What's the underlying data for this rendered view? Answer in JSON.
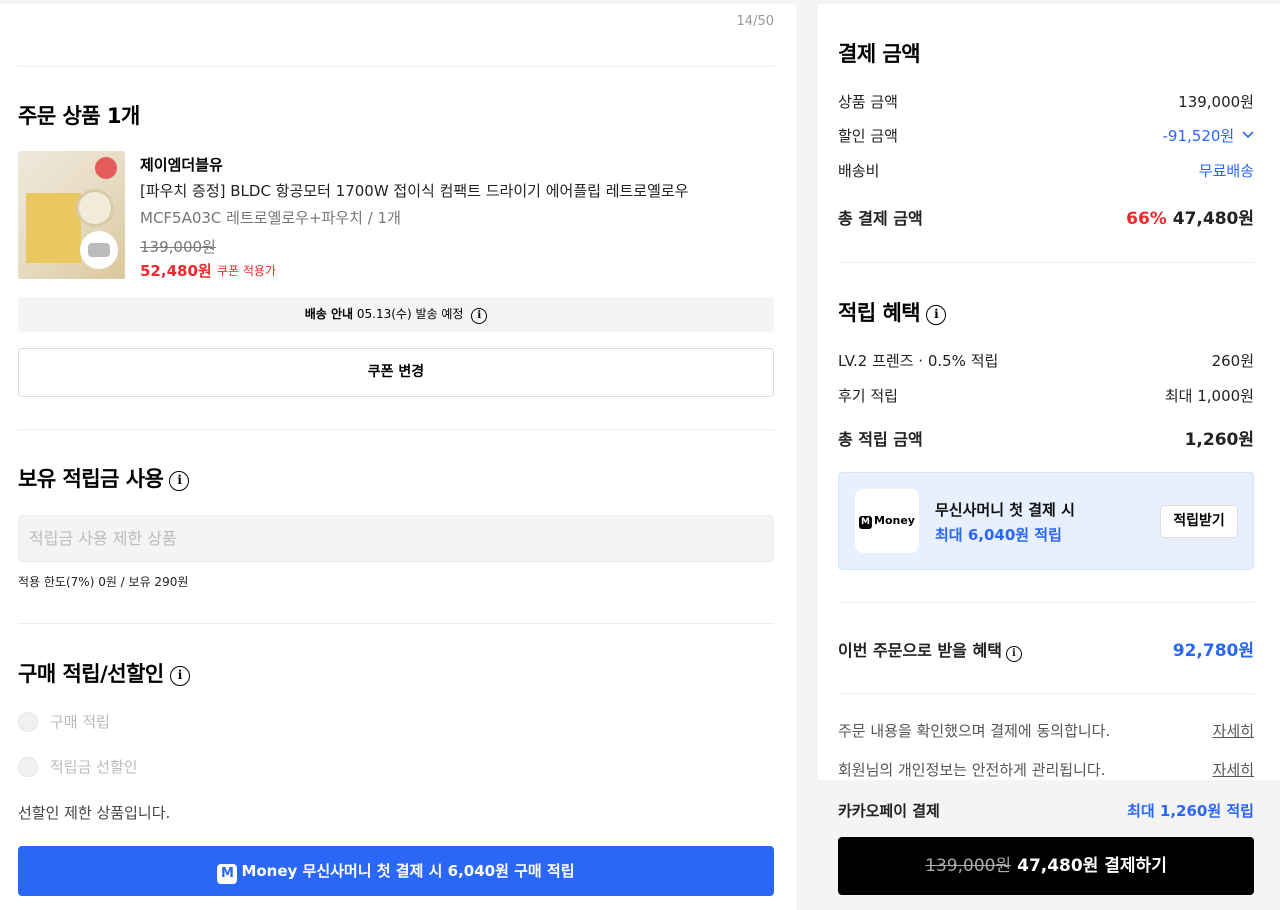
{
  "left": {
    "char_counter": "14/50",
    "order": {
      "title": "주문 상품 1개",
      "product": {
        "brand": "제이엠더블유",
        "name": "[파우치 증정] BLDC 항공모터 1700W 접이식 컴팩트 드라이기 에어플립 레트로옐로우",
        "option": "MCF5A03C 레트로옐로우+파우치 / 1개",
        "original_price": "139,000원",
        "sale_price": "52,480원",
        "sale_note": "쿠폰 적용가"
      },
      "shipping_label": "배송 안내",
      "shipping_text": "05.13(수) 발송 예정",
      "coupon_button": "쿠폰 변경"
    },
    "points": {
      "title": "보유 적립금 사용",
      "placeholder": "적립금 사용 제한 상품",
      "note": "적용 한도(7%) 0원 / 보유 290원"
    },
    "purchase": {
      "title": "구매 적립/선할인",
      "option1": "구매 적립",
      "option2": "적립금 선할인",
      "limit_note": "선할인 제한 상품입니다.",
      "money_icon": "M",
      "money_button": "Money 무신사머니 첫 결제 시 6,040원 구매 적립"
    }
  },
  "right": {
    "payment": {
      "title": "결제 금액",
      "rows": [
        {
          "label": "상품 금액",
          "value": "139,000원"
        },
        {
          "label": "할인 금액",
          "value": "-91,520원"
        },
        {
          "label": "배송비",
          "value": "무료배송"
        }
      ],
      "total_label": "총 결제 금액",
      "total_rate": "66%",
      "total_value": "47,480원"
    },
    "rewards": {
      "title": "적립 혜택",
      "rows": [
        {
          "label": "LV.2 프렌즈 · 0.5% 적립",
          "value": "260원"
        },
        {
          "label": "후기 적립",
          "value": "최대 1,000원"
        }
      ],
      "total_label": "총 적립 금액",
      "total_value": "1,260원"
    },
    "promo": {
      "logo_icon": "M",
      "logo_text": "Money",
      "title": "무신사머니 첫 결제 시",
      "subtitle": "최대 6,040원 적립",
      "button": "적립받기"
    },
    "benefit": {
      "label": "이번 주문으로 받을 혜택",
      "value": "92,780원"
    },
    "agreements": [
      {
        "text": "주문 내용을 확인했으며 결제에 동의합니다.",
        "link": "자세히"
      },
      {
        "text": "회원님의 개인정보는 안전하게 관리됩니다.",
        "link": "자세히"
      }
    ],
    "footer": {
      "method": "카카오페이 결제",
      "reward": "최대 1,260원 적립",
      "pay_original": "139,000원",
      "pay_label": "47,480원 결제하기"
    }
  },
  "colors": {
    "accent_blue": "#2b67f6",
    "sale_red": "#f0282d",
    "pay_button": "#000000"
  }
}
